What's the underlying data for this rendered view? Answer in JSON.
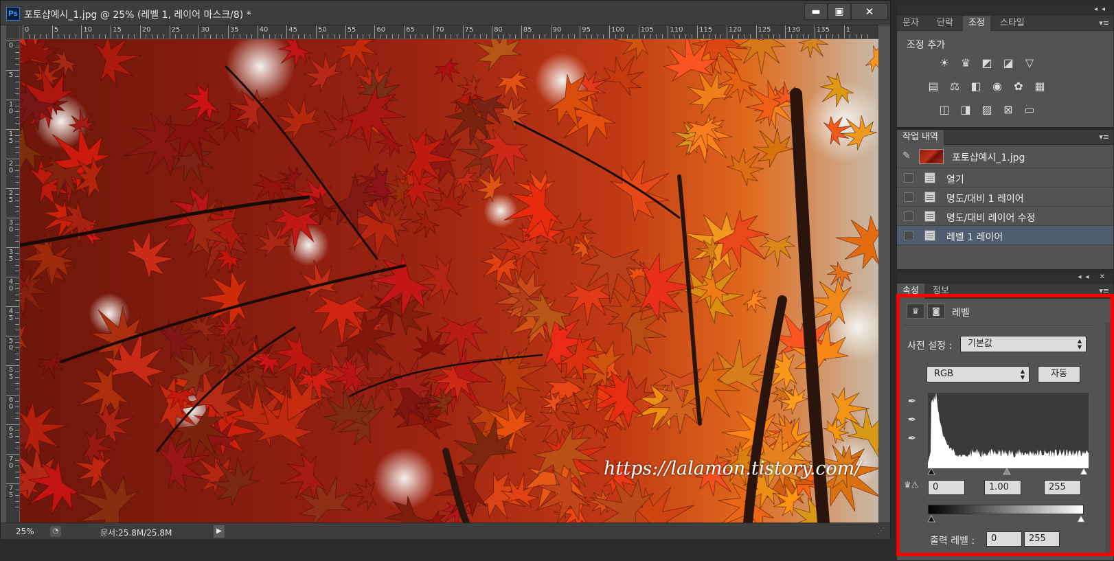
{
  "document": {
    "app_logo": "Ps",
    "title": "포토샵예시_1.jpg @ 25% (레벨 1, 레이어 마스크/8) *",
    "window_buttons": {
      "minimize": "▬",
      "maximize": "▣",
      "close": "✕"
    },
    "ruler_h_labels": [
      "0",
      "5",
      "10",
      "15",
      "20",
      "25",
      "30",
      "35",
      "40",
      "45",
      "50",
      "55",
      "60",
      "65",
      "70",
      "75",
      "80",
      "85",
      "90",
      "95",
      "100",
      "105",
      "110",
      "115",
      "120",
      "125",
      "130",
      "135",
      "1"
    ],
    "ruler_v_labels": [
      "0",
      "5",
      "10",
      "15",
      "20",
      "25",
      "30",
      "35",
      "40",
      "45",
      "50",
      "55",
      "60",
      "65",
      "70",
      "75"
    ],
    "watermark": "https://lalamon.tistory.com/",
    "status": {
      "zoom": "25%",
      "doc_size": "문서:25.8M/25.8M",
      "arrow": "▶"
    }
  },
  "adjustments_panel": {
    "tabs": [
      "문자",
      "단락",
      "조정",
      "스타일"
    ],
    "active_tab": "조정",
    "title": "조정 추가",
    "icons": [
      [
        "brightness-icon",
        "levels-icon",
        "curves-icon",
        "exposure-icon",
        "vibrance-icon"
      ],
      [
        "hue-saturation-icon",
        "color-balance-icon",
        "black-white-icon",
        "photo-filter-icon",
        "channel-mixer-icon",
        "color-lookup-icon"
      ],
      [
        "invert-icon",
        "posterize-icon",
        "threshold-icon",
        "selective-color-icon",
        "gradient-map-icon"
      ]
    ]
  },
  "history_panel": {
    "tab": "작업 내역",
    "snapshot_label": "포토샵예시_1.jpg",
    "items": [
      {
        "label": "열기",
        "selected": false
      },
      {
        "label": "명도/대비 1 레이어",
        "selected": false
      },
      {
        "label": "명도/대비 레이어 수정",
        "selected": false
      },
      {
        "label": "레벨 1 레이어",
        "selected": true
      }
    ]
  },
  "properties_panel": {
    "tabs": [
      "속성",
      "정보"
    ],
    "active_tab": "속성",
    "title": "레벨",
    "preset_label": "사전 설정 :",
    "preset_value": "기본값",
    "channel_value": "RGB",
    "auto_label": "자동",
    "input_black": "0",
    "input_gamma": "1.00",
    "input_white": "255",
    "output_label": "출력 레벨 :",
    "output_black": "0",
    "output_white": "255"
  },
  "colors": {
    "highlight_frame": "#ff0000",
    "panel_bg": "#535353",
    "selected_row": "#505d6e"
  }
}
